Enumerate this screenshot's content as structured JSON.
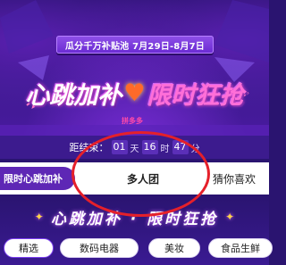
{
  "banner": {
    "top_pill": "瓜分千万补贴池 7月29日-8月7日",
    "headline_left": "心跳加补",
    "headline_heart": "♥",
    "headline_right": "限时狂抢",
    "headline_sub": "拼多多"
  },
  "countdown": {
    "label": "距结束：",
    "days": "01",
    "days_unit": "天",
    "hours": "16",
    "hours_unit": "时",
    "minutes": "47",
    "minutes_unit": "分"
  },
  "tabs": {
    "left": "限时心跳加补",
    "center": "多人团",
    "right": "猜你喜欢"
  },
  "section": {
    "title": "心跳加补 · 限时狂抢",
    "sparkle": "✦"
  },
  "chips": [
    "精选",
    "数码电器",
    "美妆",
    "食品生鲜"
  ],
  "colors": {
    "banner_purple": "#3a1a8c",
    "tab_active_bg": "#5e27b5",
    "annotation_red": "#e5202a",
    "chip_active_border": "#7b3ff0"
  }
}
